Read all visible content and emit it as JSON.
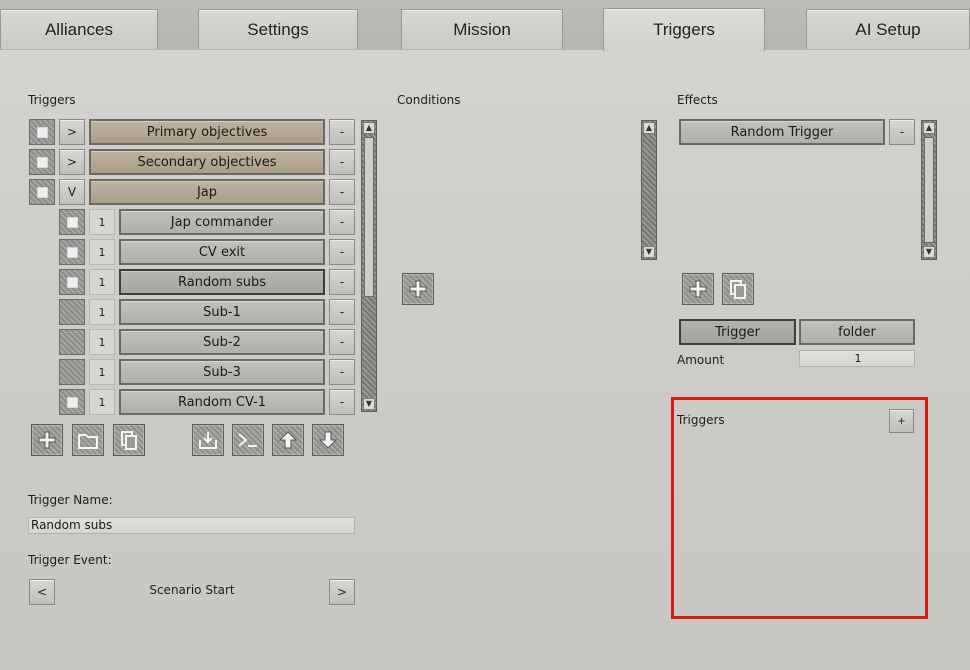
{
  "tabs": [
    {
      "label": "Alliances"
    },
    {
      "label": "Settings"
    },
    {
      "label": "Mission"
    },
    {
      "label": "Triggers",
      "active": true
    },
    {
      "label": "AI Setup"
    }
  ],
  "triggers_panel": {
    "title": "Triggers",
    "rows": [
      {
        "checked": true,
        "toggle": ">",
        "label": "Primary objectives",
        "remove": "-"
      },
      {
        "checked": true,
        "toggle": ">",
        "label": "Secondary objectives",
        "remove": "-"
      },
      {
        "checked": true,
        "toggle": "V",
        "label": "Jap",
        "remove": "-"
      },
      {
        "checked": true,
        "count": "1",
        "label": "Jap commander",
        "remove": "-"
      },
      {
        "checked": true,
        "count": "1",
        "label": "CV exit",
        "remove": "-"
      },
      {
        "checked": true,
        "count": "1",
        "label": "Random subs",
        "remove": "-",
        "selected": true
      },
      {
        "checked": false,
        "count": "1",
        "label": "Sub-1",
        "remove": "-"
      },
      {
        "checked": false,
        "count": "1",
        "label": "Sub-2",
        "remove": "-"
      },
      {
        "checked": false,
        "count": "1",
        "label": "Sub-3",
        "remove": "-"
      },
      {
        "checked": true,
        "count": "1",
        "label": "Random CV-1",
        "remove": "-"
      }
    ],
    "toolbar": [
      "add-icon",
      "folder-icon",
      "copy-icon",
      "import-icon",
      "console-icon",
      "move-up-icon",
      "move-down-icon"
    ]
  },
  "trigger_name": {
    "label": "Trigger Name:",
    "value": "Random subs"
  },
  "trigger_event": {
    "label": "Trigger Event:",
    "prev": "<",
    "value": "Scenario Start",
    "next": ">"
  },
  "conditions": {
    "title": "Conditions"
  },
  "effects": {
    "title": "Effects",
    "item": "Random Trigger",
    "remove": "-",
    "mode_trigger": "Trigger",
    "mode_folder": "folder",
    "amount_label": "Amount",
    "amount_value": "1",
    "sub_triggers_title": "Triggers",
    "sub_add": "+"
  },
  "colors": {
    "highlight": "#d81a1a",
    "folder_row": "#b3a793",
    "item_row": "#b9b7b3"
  }
}
